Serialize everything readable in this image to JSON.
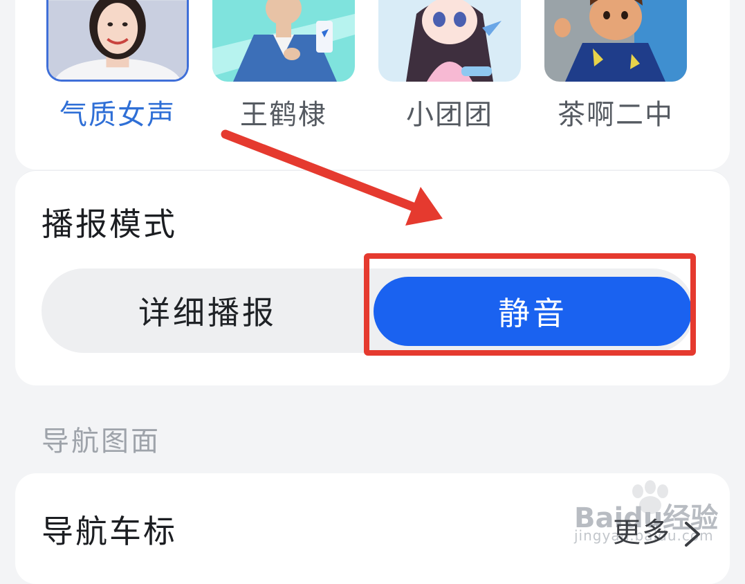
{
  "voices": [
    {
      "label": "气质女声",
      "selected": true,
      "icon": "woman-portrait"
    },
    {
      "label": "王鹤棣",
      "selected": false,
      "icon": "man-portrait"
    },
    {
      "label": "小团团",
      "selected": false,
      "icon": "anime-girl-portrait"
    },
    {
      "label": "茶啊二中",
      "selected": false,
      "icon": "cartoon-boy-portrait"
    }
  ],
  "broadcast_mode": {
    "title": "播报模式",
    "options": [
      "详细播报",
      "静音"
    ],
    "selected": "静音"
  },
  "nav_section": {
    "label": "导航图面",
    "item_title": "导航车标",
    "more": "更多"
  },
  "watermark": {
    "brand": "Baidu经验",
    "url": "jingyan.baidu.com"
  },
  "colors": {
    "accent": "#1a62f0",
    "selected_voice": "#2f6fd6",
    "annotation_red": "#e53a2f",
    "background": "#f3f4f6"
  }
}
